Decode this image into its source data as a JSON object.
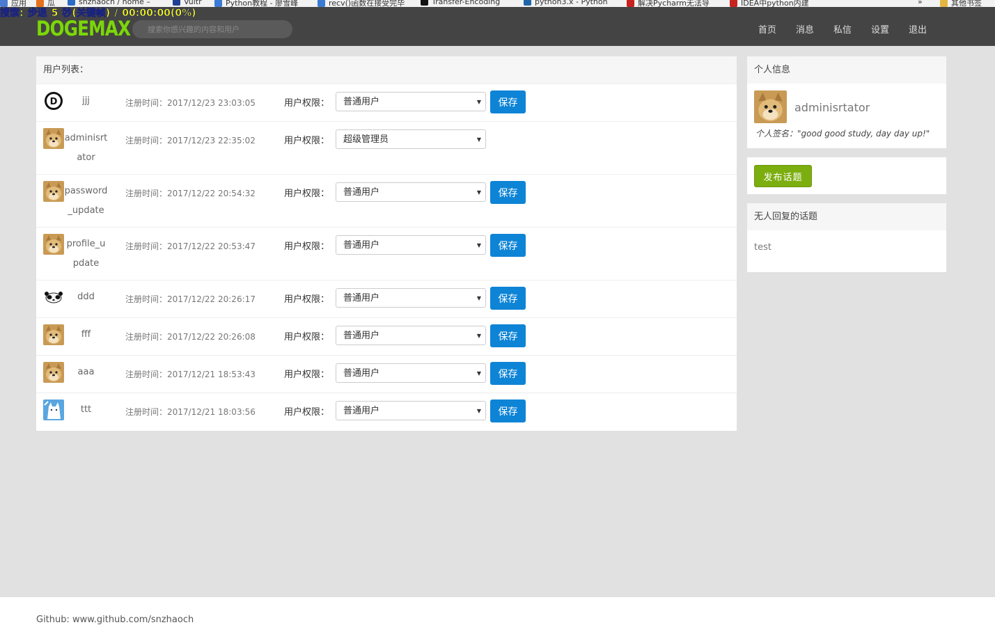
{
  "browser": {
    "bookmarks": [
      {
        "label": "应用",
        "icon": "apps-icon",
        "color": "#4a7bd0"
      },
      {
        "label": "瓜",
        "icon": "bookmark-icon",
        "color": "#e7701b"
      },
      {
        "label": "snzhaoch / home –",
        "icon": "bookmark-icon",
        "color": "#2b6cc4"
      },
      {
        "label": "Vultr",
        "icon": "bookmark-icon",
        "color": "#1f3f94"
      },
      {
        "label": "Python教程 - 廖雪峰",
        "icon": "bookmark-icon",
        "color": "#3a7bd5"
      },
      {
        "label": "recv()函数在接受完毕",
        "icon": "bookmark-icon",
        "color": "#3a7bd5"
      },
      {
        "label": "Transfer-Encoding",
        "icon": "bookmark-icon",
        "color": "#111111"
      },
      {
        "label": "python3.x - Python",
        "icon": "bookmark-icon",
        "color": "#1f64a8"
      },
      {
        "label": "解决Pycharm无法导",
        "icon": "bookmark-icon",
        "color": "#c8211e"
      },
      {
        "label": "IDEA中python内建",
        "icon": "bookmark-icon",
        "color": "#c8211e"
      },
      {
        "label": "»",
        "icon": "more-icon",
        "color": "#555555"
      },
      {
        "label": "其他书签",
        "icon": "folder-icon",
        "color": "#e3b640"
      }
    ],
    "recorder": {
      "prefix": "搜索:",
      "back": "步退",
      "seconds": "5",
      "unit": "秒(关键帧)",
      "sep": "/",
      "time": "00:00:00(0%)"
    }
  },
  "navbar": {
    "logo": "DOGEMAX",
    "search_placeholder": "搜索你感兴趣的内容和用户",
    "links": [
      "首页",
      "消息",
      "私信",
      "设置",
      "退出"
    ]
  },
  "user_list": {
    "title": "用户列表：",
    "reg_label": "注册时间：",
    "perm_label": "用户权限：",
    "save_label": "保存",
    "users": [
      {
        "name": "jjj",
        "reg": "2017/12/23 23:03:05",
        "role": "普通用户",
        "avatar": "logo-d"
      },
      {
        "name": "adminisrtator",
        "reg": "2017/12/23 22:35:02",
        "role": "超级管理员",
        "avatar": "doge"
      },
      {
        "name": "password_update",
        "reg": "2017/12/22 20:54:32",
        "role": "普通用户",
        "avatar": "doge"
      },
      {
        "name": "profile_update",
        "reg": "2017/12/22 20:53:47",
        "role": "普通用户",
        "avatar": "doge"
      },
      {
        "name": "ddd",
        "reg": "2017/12/22 20:26:17",
        "role": "普通用户",
        "avatar": "panda"
      },
      {
        "name": "fff",
        "reg": "2017/12/22 20:26:08",
        "role": "普通用户",
        "avatar": "doge"
      },
      {
        "name": "aaa",
        "reg": "2017/12/21 18:53:43",
        "role": "普通用户",
        "avatar": "doge"
      },
      {
        "name": "ttt",
        "reg": "2017/12/21 18:03:56",
        "role": "普通用户",
        "avatar": "cat"
      }
    ]
  },
  "profile": {
    "title": "个人信息",
    "name": "adminisrtator",
    "signature": "个人签名：\"good good study, day day up!\""
  },
  "post_topic": {
    "label": "发布话题"
  },
  "no_reply": {
    "title": "无人回复的话题",
    "topics": [
      "test"
    ]
  },
  "footer": {
    "text": "Github: www.github.com/snzhaoch"
  }
}
